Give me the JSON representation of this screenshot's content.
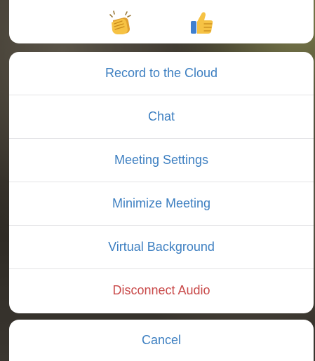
{
  "reactions": {
    "items": [
      {
        "name": "clapping-hands-icon"
      },
      {
        "name": "thumbs-up-icon"
      }
    ]
  },
  "menu": {
    "items": [
      {
        "label": "Record to the Cloud",
        "style": "default"
      },
      {
        "label": "Chat",
        "style": "default"
      },
      {
        "label": "Meeting Settings",
        "style": "default"
      },
      {
        "label": "Minimize Meeting",
        "style": "default"
      },
      {
        "label": "Virtual Background",
        "style": "default"
      },
      {
        "label": "Disconnect Audio",
        "style": "destructive"
      }
    ]
  },
  "cancel": {
    "label": "Cancel"
  },
  "colors": {
    "action_blue": "#3d7fc1",
    "destructive_red": "#c94a4a",
    "sheet_background": "#ffffff",
    "separator": "#e3e3e6"
  }
}
